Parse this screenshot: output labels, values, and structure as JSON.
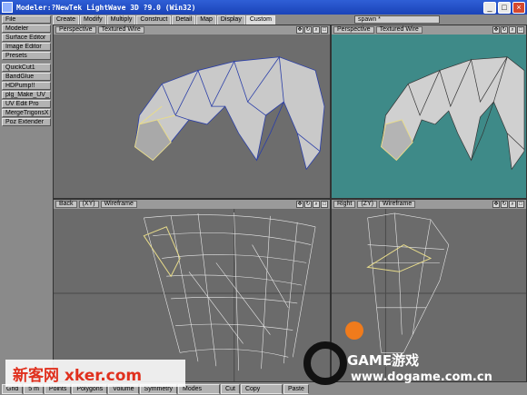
{
  "window": {
    "title": "Modeler:?NewTek LightWave 3D ?9.0 (Win32)"
  },
  "sidebar": {
    "top_items": [
      "File",
      "Modeler",
      "Surface Editor",
      "Image Editor",
      "Presets"
    ],
    "plugin_items": [
      "QuickCut1",
      "BandGlue",
      "HDPump!!",
      "plg_Make_UV_",
      "UV Edit Pro",
      "MergeTrigonsX",
      "Poz Extender"
    ]
  },
  "tabs": [
    {
      "label": "Create"
    },
    {
      "label": "Modify"
    },
    {
      "label": "Multiply"
    },
    {
      "label": "Construct"
    },
    {
      "label": "Detail"
    },
    {
      "label": "Map"
    },
    {
      "label": "Display"
    },
    {
      "label": "Custom"
    }
  ],
  "layer_select": {
    "value": "spawn *"
  },
  "viewports": {
    "top_left": {
      "view": "Perspective",
      "render": "Textured Wire"
    },
    "top_right": {
      "view": "Perspective",
      "render": "Textured Wire"
    },
    "bottom_left": {
      "view": "Back",
      "axis": "(XY)",
      "render": "Wireframe"
    },
    "bottom_right": {
      "view": "Right",
      "axis": "(ZY)",
      "render": "Wireframe"
    }
  },
  "bottombar": {
    "items": [
      "Grid",
      "5 m",
      "Points",
      "Polygons",
      "Volume",
      "Symmetry",
      "Modes",
      "Cut",
      "Copy",
      "Paste"
    ]
  },
  "watermarks": {
    "left": "新客网 xker.com",
    "game": "GAME游戏",
    "url": "www.dogame.com.cn"
  },
  "colors": {
    "accent_active_tab": "#dcdcdc",
    "viewport_bg": "#6b6b6b",
    "perspective_bg_right": "#3e8a88",
    "wire_blue": "#2a3ea8",
    "wire_white": "#e8e8e8",
    "selected_yellow": "#e8dc8a",
    "watermark_red": "#e0301e"
  },
  "icons": [
    "move-view-icon",
    "rotate-view-icon",
    "zoom-view-icon",
    "maximize-view-icon"
  ]
}
